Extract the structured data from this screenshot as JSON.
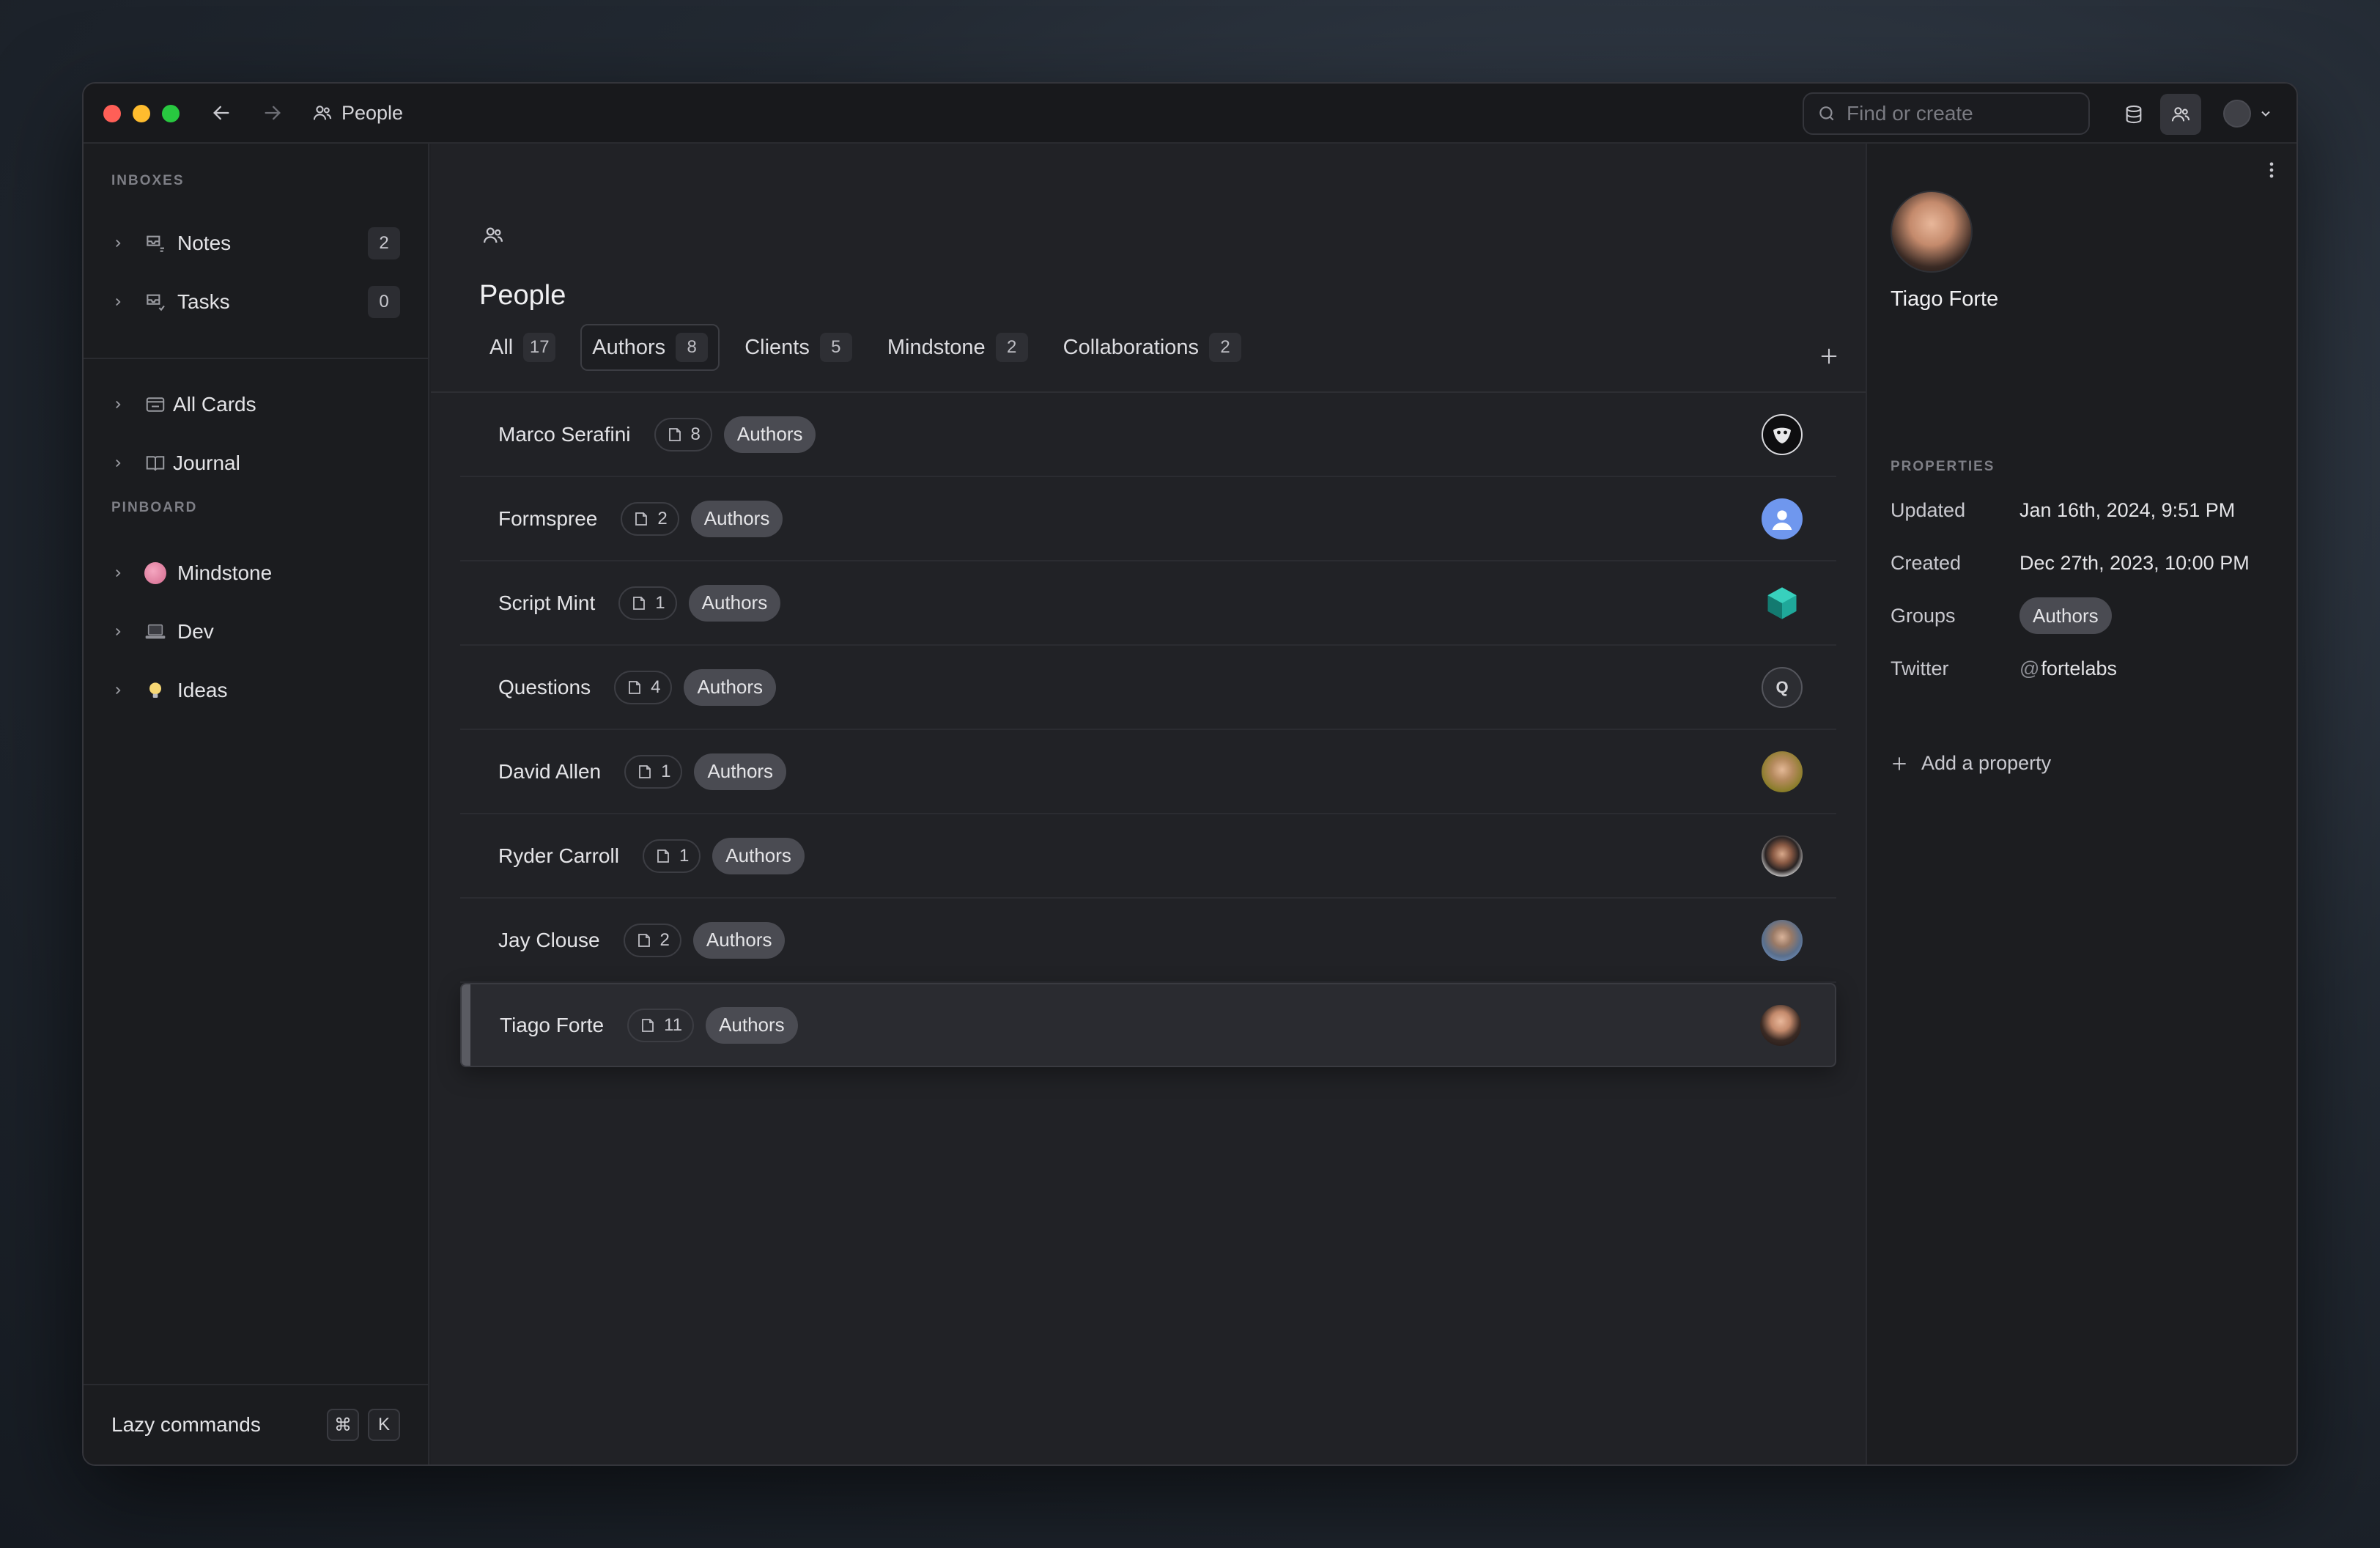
{
  "window": {
    "title": "People"
  },
  "search": {
    "placeholder": "Find or create"
  },
  "sidebar": {
    "inboxes_label": "INBOXES",
    "inboxes": [
      {
        "label": "Notes",
        "count": "2"
      },
      {
        "label": "Tasks",
        "count": "0"
      }
    ],
    "items": [
      {
        "label": "All Cards"
      },
      {
        "label": "Journal"
      }
    ],
    "pinboard_label": "PINBOARD",
    "pinboard": [
      {
        "label": "Mindstone"
      },
      {
        "label": "Dev"
      },
      {
        "label": "Ideas"
      }
    ],
    "lazy_commands": "Lazy commands",
    "kbd_cmd": "⌘",
    "kbd_k": "K"
  },
  "main": {
    "title": "People",
    "tabs": [
      {
        "label": "All",
        "count": "17"
      },
      {
        "label": "Authors",
        "count": "8"
      },
      {
        "label": "Clients",
        "count": "5"
      },
      {
        "label": "Mindstone",
        "count": "2"
      },
      {
        "label": "Collaborations",
        "count": "2"
      }
    ],
    "rows": [
      {
        "name": "Marco Serafini",
        "cards": "8",
        "tag": "Authors"
      },
      {
        "name": "Formspree",
        "cards": "2",
        "tag": "Authors"
      },
      {
        "name": "Script Mint",
        "cards": "1",
        "tag": "Authors"
      },
      {
        "name": "Questions",
        "cards": "4",
        "tag": "Authors",
        "initial": "Q"
      },
      {
        "name": "David Allen",
        "cards": "1",
        "tag": "Authors"
      },
      {
        "name": "Ryder Carroll",
        "cards": "1",
        "tag": "Authors"
      },
      {
        "name": "Jay Clouse",
        "cards": "2",
        "tag": "Authors"
      },
      {
        "name": "Tiago Forte",
        "cards": "11",
        "tag": "Authors"
      }
    ]
  },
  "panel": {
    "name": "Tiago Forte",
    "properties_label": "PROPERTIES",
    "properties": {
      "updated_label": "Updated",
      "updated_value": "Jan 16th, 2024, 9:51 PM",
      "created_label": "Created",
      "created_value": "Dec 27th, 2023, 10:00 PM",
      "groups_label": "Groups",
      "groups_value": "Authors",
      "twitter_label": "Twitter",
      "twitter_at": "@",
      "twitter_value": "fortelabs"
    },
    "add_property": "Add a property"
  },
  "colors": {
    "window_bg": "#1f2024",
    "sidebar_bg": "#1b1c1f",
    "tag_bg": "#4a4b52",
    "traffic_red": "#ff5f57",
    "traffic_yellow": "#febc2e",
    "traffic_green": "#28c840"
  }
}
